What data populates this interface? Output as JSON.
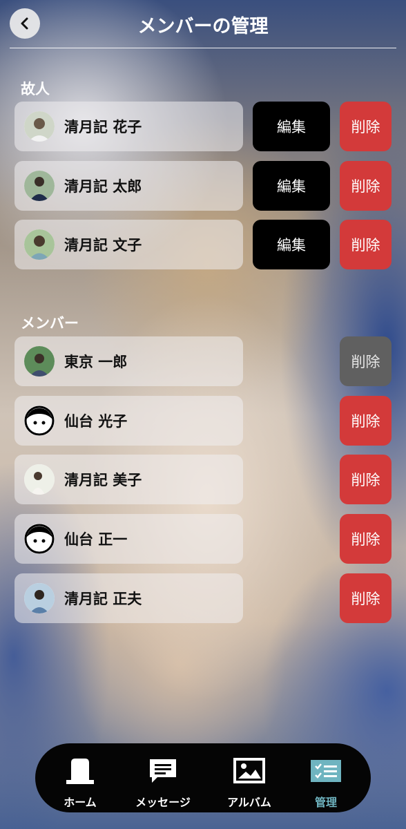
{
  "header": {
    "title": "メンバーの管理",
    "back_icon": "chevron-left-icon"
  },
  "deceased": {
    "title": "故人",
    "items": [
      {
        "name": "清月記 花子",
        "avatar": "photo",
        "edit_label": "編集",
        "delete_label": "削除"
      },
      {
        "name": "清月記 太郎",
        "avatar": "photo",
        "edit_label": "編集",
        "delete_label": "削除"
      },
      {
        "name": "清月記 文子",
        "avatar": "photo",
        "edit_label": "編集",
        "delete_label": "削除"
      }
    ]
  },
  "members": {
    "title": "メンバー",
    "items": [
      {
        "name": "東京 一郎",
        "avatar": "photo",
        "delete_label": "削除",
        "delete_disabled": true
      },
      {
        "name": "仙台 光子",
        "avatar": "default-face-icon",
        "delete_label": "削除"
      },
      {
        "name": "清月記 美子",
        "avatar": "photo",
        "delete_label": "削除"
      },
      {
        "name": "仙台 正一",
        "avatar": "default-face-icon",
        "delete_label": "削除"
      },
      {
        "name": "清月記 正夫",
        "avatar": "photo",
        "delete_label": "削除"
      }
    ]
  },
  "colors": {
    "delete": "#d33a3a",
    "delete_disabled": "#606060",
    "edit": "#000000",
    "nav_active": "#6fb4c0"
  },
  "nav": {
    "items": [
      {
        "label": "ホーム",
        "icon": "grave-icon"
      },
      {
        "label": "メッセージ",
        "icon": "message-icon"
      },
      {
        "label": "アルバム",
        "icon": "image-icon"
      },
      {
        "label": "管理",
        "icon": "checklist-icon",
        "active": true
      }
    ]
  }
}
